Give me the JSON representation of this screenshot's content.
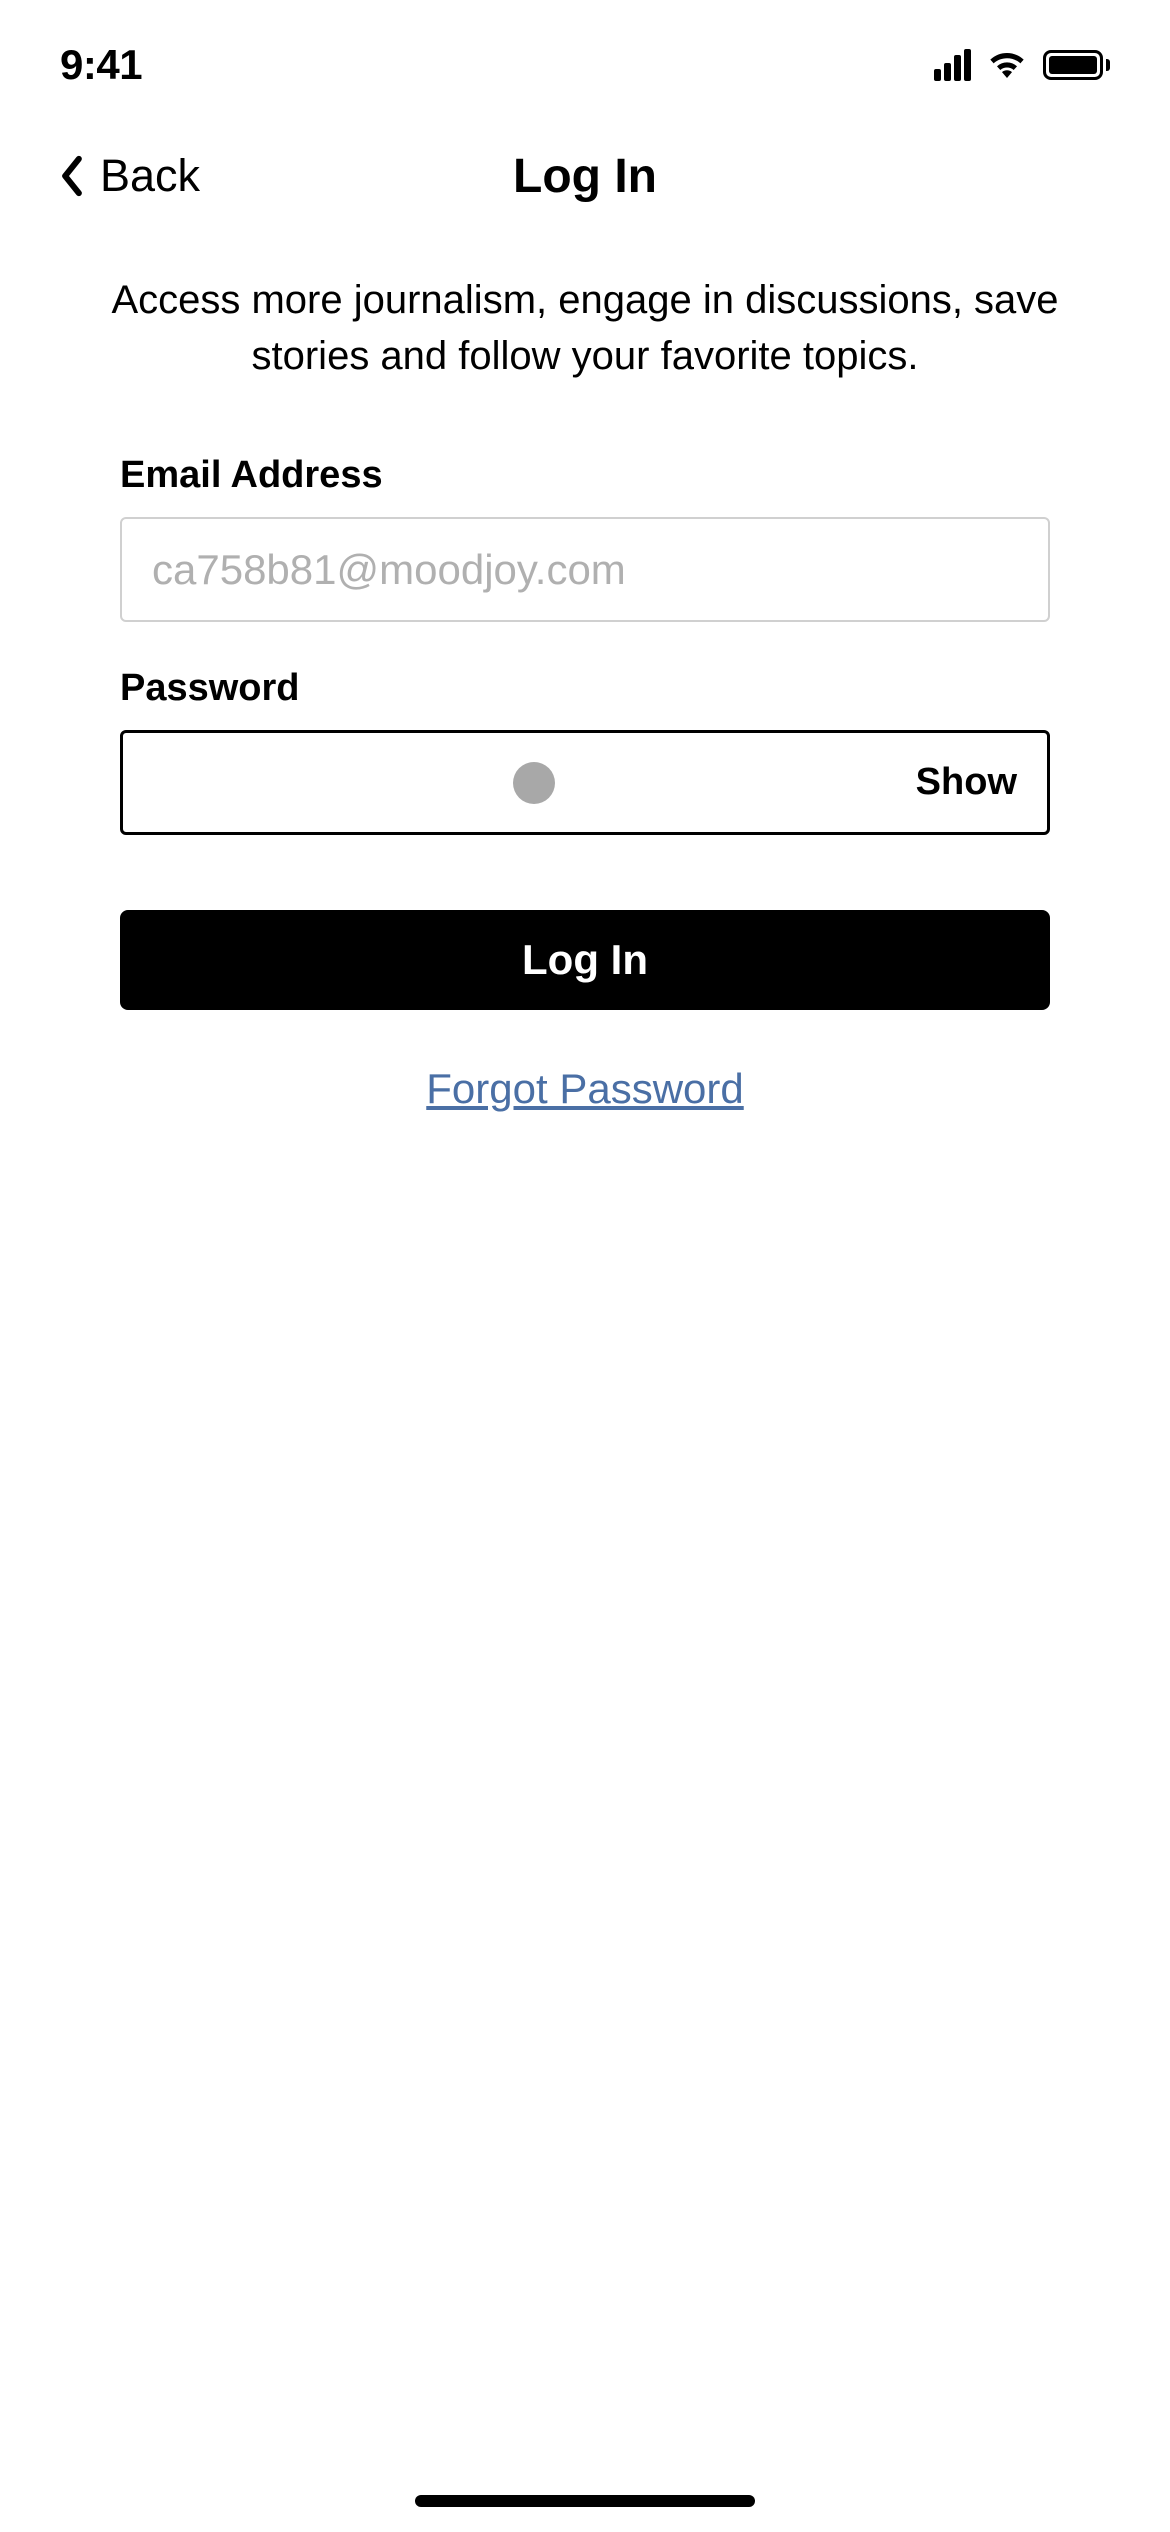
{
  "statusBar": {
    "time": "9:41"
  },
  "navBar": {
    "backLabel": "Back",
    "title": "Log In"
  },
  "subtitle": "Access more journalism, engage in discussions, save stories and follow your favorite topics.",
  "form": {
    "emailLabel": "Email Address",
    "emailPlaceholder": "ca758b81@moodjoy.com",
    "passwordLabel": "Password",
    "showLabel": "Show",
    "loginButtonLabel": "Log In",
    "forgotPasswordLabel": "Forgot Password"
  }
}
